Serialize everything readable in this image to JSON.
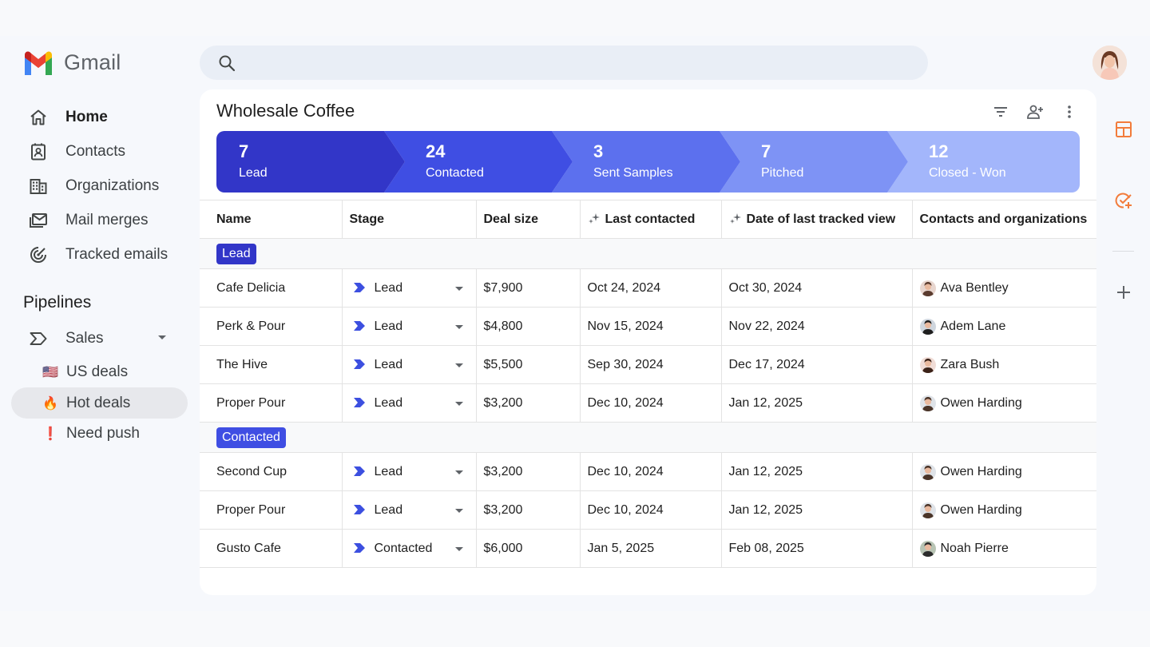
{
  "app": {
    "name": "Gmail"
  },
  "search": {
    "placeholder": ""
  },
  "nav": [
    {
      "label": "Home",
      "icon": "home-icon"
    },
    {
      "label": "Contacts",
      "icon": "contacts-icon"
    },
    {
      "label": "Organizations",
      "icon": "organizations-icon"
    },
    {
      "label": "Mail merges",
      "icon": "mail-merge-icon"
    },
    {
      "label": "Tracked emails",
      "icon": "tracked-emails-icon"
    }
  ],
  "pipelines": {
    "title": "Pipelines",
    "sales_label": "Sales",
    "views": [
      {
        "emoji": "🇺🇸",
        "label": "US deals"
      },
      {
        "emoji": "🔥",
        "label": "Hot deals"
      },
      {
        "emoji": "❗",
        "label": "Need push"
      }
    ]
  },
  "board": {
    "title": "Wholesale Coffee",
    "stages": [
      {
        "count": "7",
        "name": "Lead",
        "color": "#3236c8"
      },
      {
        "count": "24",
        "name": "Contacted",
        "color": "#3f4ee3"
      },
      {
        "count": "3",
        "name": "Sent Samples",
        "color": "#5c70ee"
      },
      {
        "count": "7",
        "name": "Pitched",
        "color": "#7e93f5"
      },
      {
        "count": "12",
        "name": "Closed - Won",
        "color": "#a3b6fb"
      }
    ]
  },
  "table": {
    "headers": [
      "Name",
      "Stage",
      "Deal size",
      "Last contacted",
      "Date of last tracked view",
      "Contacts and organizations"
    ],
    "groups": [
      {
        "label": "Lead",
        "color": "#3236c8",
        "rows": [
          {
            "name": "Cafe Delicia",
            "stage": "Lead",
            "deal": "$7,900",
            "last": "Oct 24, 2024",
            "viewed": "Oct 30, 2024",
            "contact": "Ava Bentley"
          },
          {
            "name": "Perk & Pour",
            "stage": "Lead",
            "deal": "$4,800",
            "last": "Nov 15, 2024",
            "viewed": "Nov 22, 2024",
            "contact": "Adem Lane"
          },
          {
            "name": "The Hive",
            "stage": "Lead",
            "deal": "$5,500",
            "last": "Sep 30, 2024",
            "viewed": "Dec 17, 2024",
            "contact": "Zara Bush"
          },
          {
            "name": "Proper Pour",
            "stage": "Lead",
            "deal": "$3,200",
            "last": "Dec 10, 2024",
            "viewed": "Jan 12, 2025",
            "contact": "Owen Harding"
          }
        ]
      },
      {
        "label": "Contacted",
        "color": "#3f4ee3",
        "rows": [
          {
            "name": "Second Cup",
            "stage": "Lead",
            "deal": "$3,200",
            "last": "Dec 10, 2024",
            "viewed": "Jan 12, 2025",
            "contact": "Owen Harding"
          },
          {
            "name": "Proper Pour",
            "stage": "Lead",
            "deal": "$3,200",
            "last": "Dec 10, 2024",
            "viewed": "Jan 12, 2025",
            "contact": "Owen Harding"
          },
          {
            "name": "Gusto Cafe",
            "stage": "Contacted",
            "deal": "$6,000",
            "last": "Jan 5, 2025",
            "viewed": "Feb 08, 2025",
            "contact": "Noah Pierre"
          }
        ]
      }
    ]
  },
  "colors": {
    "accent": "#3c4fe0",
    "rail_orange": "#f27c3b"
  }
}
